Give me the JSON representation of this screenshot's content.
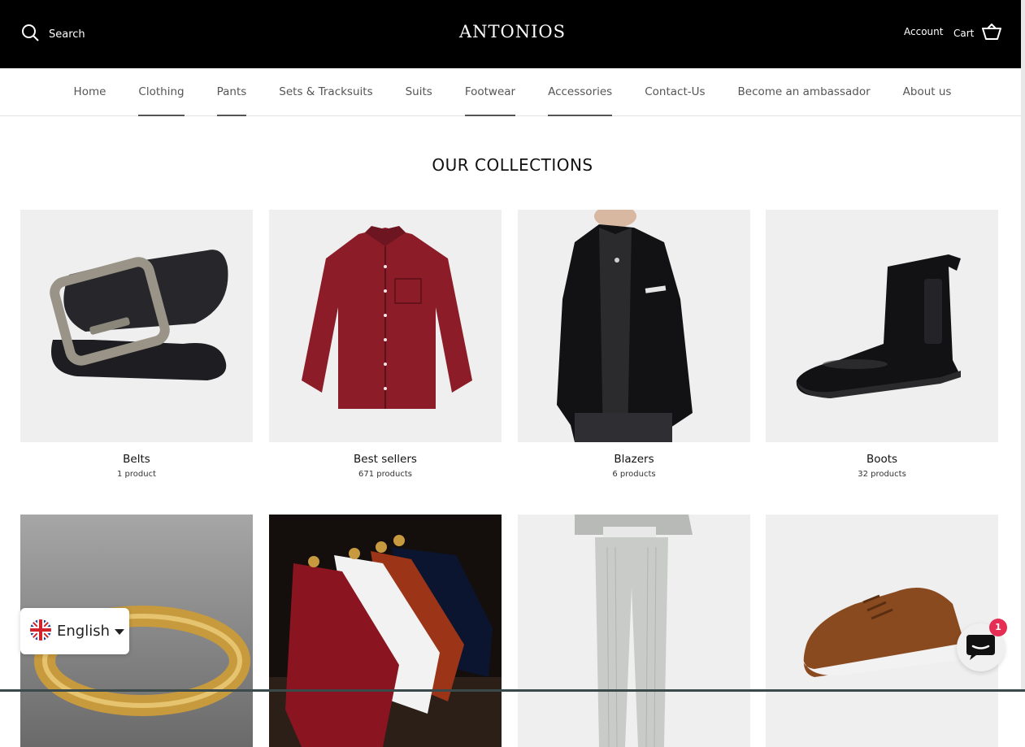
{
  "header": {
    "search_label": "Search",
    "logo": "ANTONIOS",
    "account_label": "Account",
    "cart_label": "Cart"
  },
  "nav": {
    "items": [
      {
        "label": "Home",
        "dropdown": false
      },
      {
        "label": "Clothing",
        "dropdown": true
      },
      {
        "label": "Pants",
        "dropdown": true
      },
      {
        "label": "Sets & Tracksuits",
        "dropdown": false
      },
      {
        "label": "Suits",
        "dropdown": false
      },
      {
        "label": "Footwear",
        "dropdown": true
      },
      {
        "label": "Accessories",
        "dropdown": true
      },
      {
        "label": "Contact-Us",
        "dropdown": false
      },
      {
        "label": "Become an ambassador",
        "dropdown": false
      },
      {
        "label": "About us",
        "dropdown": false
      }
    ]
  },
  "main": {
    "title": "OUR COLLECTIONS",
    "collections": [
      {
        "name": "Belts",
        "count": "1 product"
      },
      {
        "name": "Best sellers",
        "count": "671 products"
      },
      {
        "name": "Blazers",
        "count": "6 products"
      },
      {
        "name": "Boots",
        "count": "32 products"
      },
      {
        "name": "",
        "count": ""
      },
      {
        "name": "",
        "count": ""
      },
      {
        "name": "",
        "count": ""
      },
      {
        "name": "",
        "count": ""
      }
    ]
  },
  "language": {
    "label": "English"
  },
  "chat": {
    "badge": "1"
  },
  "colors": {
    "header_bg": "#000000",
    "badge": "#e62e55",
    "card_bg": "#efefef"
  }
}
